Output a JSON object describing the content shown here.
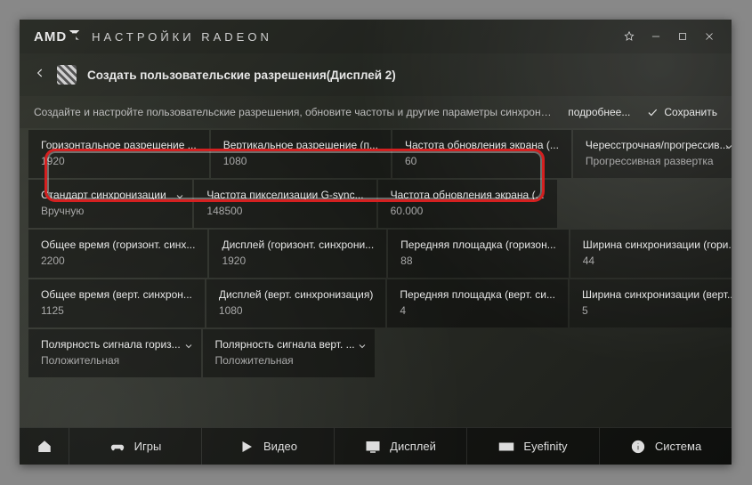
{
  "titlebar": {
    "brand": "AMD",
    "title": "НАСТРОЙКИ RADEON"
  },
  "subheader": {
    "title": "Создать пользовательские разрешения(Дисплей 2)"
  },
  "desc": {
    "text": "Создайте и настройте пользовательские разрешения, обновите частоты и другие параметры синхронизации....",
    "more": "подробнее...",
    "save": "Сохранить"
  },
  "rows": [
    [
      {
        "label": "Горизонтальное разрешение ...",
        "value": "1920"
      },
      {
        "label": "Вертикальное разрешение (п...",
        "value": "1080"
      },
      {
        "label": "Частота обновления экрана (...",
        "value": "60"
      },
      {
        "label": "Чересстрочная/прогрессив...",
        "value": "Прогрессивная развертка",
        "chev": true,
        "light": true
      }
    ],
    [
      {
        "label": "Стандарт синхронизации",
        "value": "Вручную",
        "chev": true
      },
      {
        "label": "Частота пикселизации G-sync...",
        "value": "148500"
      },
      {
        "label": "Частота обновления экрана (...",
        "value": "60.000"
      },
      {
        "empty": true
      }
    ],
    [
      {
        "label": "Общее время (горизонт. синх...",
        "value": "2200"
      },
      {
        "label": "Дисплей (горизонт. синхрони...",
        "value": "1920"
      },
      {
        "label": "Передняя площадка (горизон...",
        "value": "88"
      },
      {
        "label": "Ширина синхронизации (гори...",
        "value": "44",
        "light": true
      }
    ],
    [
      {
        "label": "Общее время (верт. синхрон...",
        "value": "1125"
      },
      {
        "label": "Дисплей (верт. синхронизация)",
        "value": "1080"
      },
      {
        "label": "Передняя площадка (верт. си...",
        "value": "4"
      },
      {
        "label": "Ширина синхронизации (верт...",
        "value": "5",
        "light": true
      }
    ],
    [
      {
        "label": "Полярность сигнала гориз...",
        "value": "Положительная",
        "chev": true
      },
      {
        "label": "Полярность сигнала верт. ...",
        "value": "Положительная",
        "chev": true
      },
      {
        "empty": true
      },
      {
        "empty": true
      }
    ]
  ],
  "nav": {
    "games": "Игры",
    "video": "Видео",
    "display": "Дисплей",
    "eyefinity": "Eyefinity",
    "system": "Система"
  }
}
